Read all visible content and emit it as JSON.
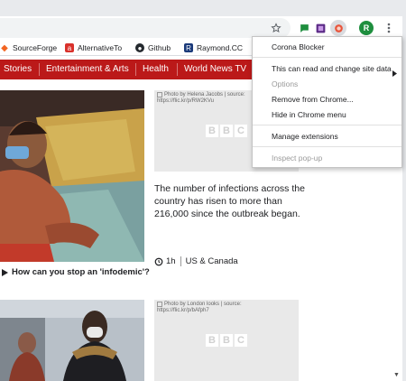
{
  "toolbar": {
    "star_icon": "star-icon",
    "extension_profile_letter": "R",
    "menu_icon": "three-dots-icon"
  },
  "bookmarks": [
    {
      "label": "SourceForge",
      "icon": "sourceforge-icon"
    },
    {
      "label": "AlternativeTo",
      "icon": "alternativeto-icon"
    },
    {
      "label": "Github",
      "icon": "github-icon"
    },
    {
      "label": "Raymond.CC",
      "icon": "raymondcc-icon"
    }
  ],
  "nav": {
    "items": [
      "Stories",
      "Entertainment & Arts",
      "Health",
      "World News TV"
    ]
  },
  "articles": {
    "photo1_alt": "Photo by Helena Jacobs | source: https://flic.kr/p/RW2KVu",
    "summary": "The number of infections across the country has risen to more than 216,000 since the outbreak began.",
    "time_ago": "1h",
    "section": "US & Canada",
    "headline2": "How can you stop an 'infodemic'?",
    "photo2_alt": "Photo by London looks | source: https://flic.kr/p/bAfph7",
    "bbc_letters": [
      "B",
      "B",
      "C"
    ]
  },
  "context_menu": {
    "title": "Corona Blocker",
    "site_access": "This can read and change site data",
    "options": "Options",
    "remove": "Remove from Chrome...",
    "hide": "Hide in Chrome menu",
    "manage": "Manage extensions",
    "inspect": "Inspect pop-up"
  },
  "colors": {
    "bbc_red": "#bb1919",
    "profile_green": "#1e8e3e"
  }
}
